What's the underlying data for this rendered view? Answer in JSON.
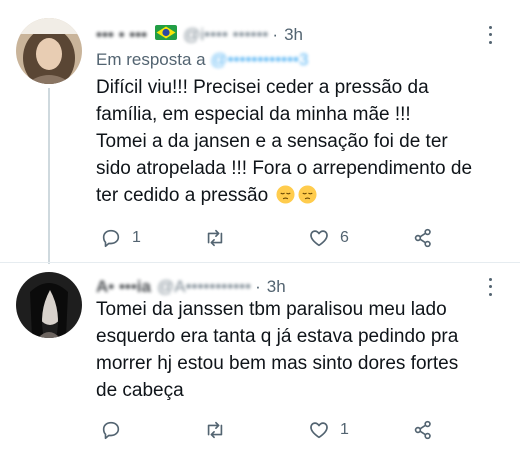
{
  "tweets": [
    {
      "name": "••• • •••",
      "handle": "@i•••• ••••••",
      "time": "3h",
      "reply_prefix": "Em resposta a ",
      "reply_handle": "@••••••••••••3",
      "text_lines": [
        "Difícil viu!!! Precisei ceder a pressão da",
        "família, em especial da minha mãe !!!",
        "Tomei a da jansen e a sensação foi de ter",
        "sido atropelada !!! Fora o arrependimento de",
        "ter cedido a pressão"
      ],
      "reply_count": "1",
      "retweet_count": "",
      "like_count": "6"
    },
    {
      "name": "A• •••ia",
      "handle": "@A•••••••••••",
      "time": "3h",
      "text_lines": [
        "Tomei da janssen tbm paralisou meu lado",
        "esquerdo era tanta q já estava pedindo pra",
        "morrer hj estou bem mas sinto dores fortes",
        "de cabeça"
      ],
      "reply_count": "",
      "retweet_count": "",
      "like_count": "1"
    }
  ],
  "colors": {
    "text": "#0f1419",
    "secondary": "#536471",
    "link": "#1d9bf0",
    "thread_line": "#cfd9de"
  },
  "icons": [
    "brazil-flag-icon",
    "pensive-face-emoji",
    "reply-icon",
    "retweet-icon",
    "heart-icon",
    "share-icon",
    "more-icon"
  ]
}
